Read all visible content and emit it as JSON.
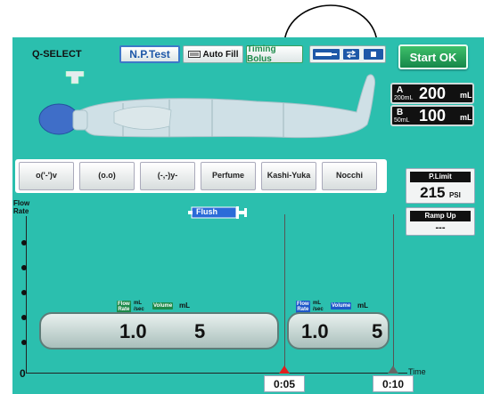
{
  "header": {
    "title": "Q-SELECT",
    "np_test": "N.P.Test",
    "auto_fill": "Auto Fill",
    "timing_bolus": "Timing Bolus",
    "start": "Start OK"
  },
  "volumes": {
    "a": {
      "letter": "A",
      "capacity": "200mL",
      "value": "200",
      "unit": "mL"
    },
    "b": {
      "letter": "B",
      "capacity": "50mL",
      "value": "100",
      "unit": "mL"
    }
  },
  "protocols": [
    {
      "label": "o('-')v",
      "selected": true
    },
    {
      "label": "(o.o)",
      "selected": false
    },
    {
      "label": "(-,-)y-",
      "selected": true
    },
    {
      "label": "Perfume",
      "selected": false
    },
    {
      "label": "Kashi-Yuka",
      "selected": false
    },
    {
      "label": "Nocchi",
      "selected": false
    }
  ],
  "p_limit": {
    "title": "P.Limit",
    "value": "215",
    "unit": "PSI"
  },
  "ramp_up": {
    "title": "Ramp Up",
    "value": "---"
  },
  "axis": {
    "y_label_1": "Flow",
    "y_label_2": "Rate",
    "zero": "0",
    "time": "Time"
  },
  "flush": "Flush",
  "phases": [
    {
      "flow_tag_1": "Flow",
      "flow_tag_2": "Rate",
      "flow_unit_1": "mL",
      "flow_unit_2": "/sec",
      "volume_tag": "Volume",
      "volume_unit": "mL",
      "flow_value": "1.0",
      "volume_value": "5",
      "color": "#1d8a4a"
    },
    {
      "flow_tag_1": "Flow",
      "flow_tag_2": "Rate",
      "flow_unit_1": "mL",
      "flow_unit_2": "/sec",
      "volume_tag": "Volume",
      "volume_unit": "mL",
      "flow_value": "1.0",
      "volume_value": "5",
      "color": "#1e58c8"
    }
  ],
  "time_markers": [
    {
      "value": "0:05"
    },
    {
      "value": "0:10"
    }
  ]
}
